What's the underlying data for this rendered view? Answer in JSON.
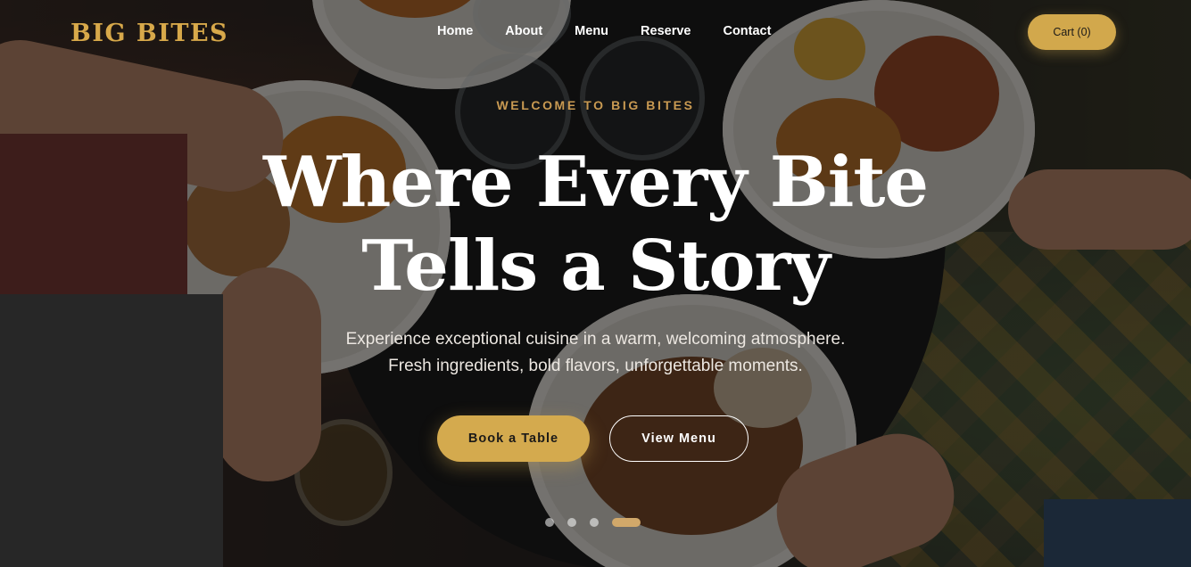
{
  "brand": {
    "name": "BIG BITES",
    "accent_color": "#d4aa4e"
  },
  "nav": {
    "items": [
      "Home",
      "About",
      "Menu",
      "Reserve",
      "Contact"
    ]
  },
  "cart": {
    "label": "Cart (0)"
  },
  "hero": {
    "eyebrow": "WELCOME TO BIG BITES",
    "headline_line1": "Where Every Bite",
    "headline_line2": "Tells a Story",
    "subtext_line1": "Experience exceptional cuisine in a warm, welcoming atmosphere.",
    "subtext_line2": "Fresh ingredients, bold flavors, unforgettable moments.",
    "primary_cta": "Book a Table",
    "secondary_cta": "View Menu"
  },
  "carousel": {
    "slide_count": 4,
    "active_index": 3
  }
}
